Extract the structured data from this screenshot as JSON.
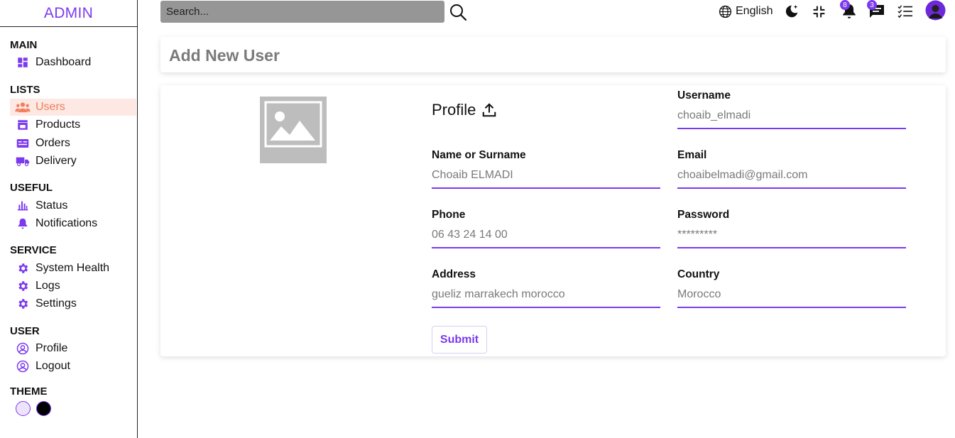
{
  "app": {
    "logo": "ADMIN"
  },
  "sidebar": {
    "sections": [
      {
        "title": "MAIN"
      },
      {
        "title": "LISTS"
      },
      {
        "title": "USEFUL"
      },
      {
        "title": "SERVICE"
      },
      {
        "title": "USER"
      },
      {
        "title": "THEME"
      }
    ],
    "items": [
      {
        "label": "Dashboard",
        "icon": "dashboard-icon"
      },
      {
        "label": "Users",
        "icon": "users-icon",
        "active": true
      },
      {
        "label": "Products",
        "icon": "store-icon"
      },
      {
        "label": "Orders",
        "icon": "credit-card-icon"
      },
      {
        "label": "Delivery",
        "icon": "truck-icon"
      },
      {
        "label": "Status",
        "icon": "bar-chart-icon"
      },
      {
        "label": "Notifications",
        "icon": "bell-icon"
      },
      {
        "label": "System Health",
        "icon": "gear-icon"
      },
      {
        "label": "Logs",
        "icon": "gear-icon"
      },
      {
        "label": "Settings",
        "icon": "gear-icon"
      },
      {
        "label": "Profile",
        "icon": "user-circle-icon"
      },
      {
        "label": "Logout",
        "icon": "user-circle-icon"
      }
    ],
    "theme_colors": [
      "#ede4fb",
      "#000000"
    ]
  },
  "topbar": {
    "search_placeholder": "Search...",
    "language": "English",
    "notifications_count": "8",
    "messages_count": "3"
  },
  "page": {
    "title": "Add New User"
  },
  "form": {
    "profile_label": "Profile",
    "fields": [
      {
        "label": "Username",
        "placeholder": "choaib_elmadi"
      },
      {
        "label": "Name or Surname",
        "placeholder": "Choaib ELMADI"
      },
      {
        "label": "Email",
        "placeholder": "choaibelmadi@gmail.com"
      },
      {
        "label": "Phone",
        "placeholder": "06 43 24 14 00"
      },
      {
        "label": "Password",
        "placeholder": "*********"
      },
      {
        "label": "Address",
        "placeholder": "gueliz marrakech morocco"
      },
      {
        "label": "Country",
        "placeholder": "Morocco"
      }
    ],
    "submit_label": "Submit"
  },
  "colors": {
    "accent": "#7c3aed",
    "active_item": "#f0805e",
    "active_bg": "#fde8e3"
  }
}
